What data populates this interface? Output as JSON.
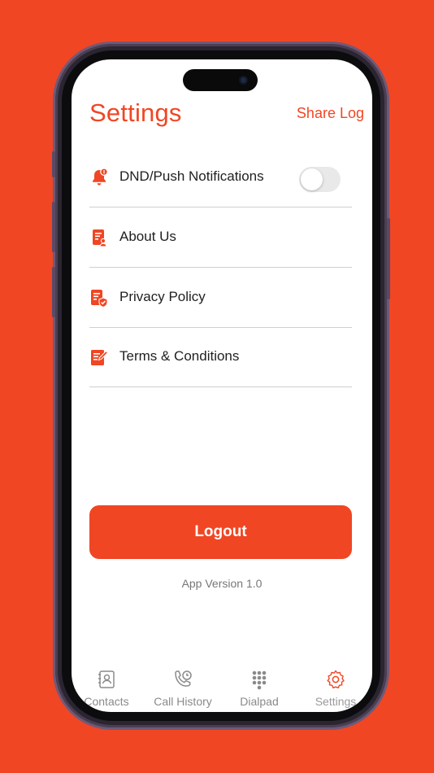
{
  "colors": {
    "accent": "#F04624",
    "background": "#F04624",
    "divider": "#cfcfcf"
  },
  "header": {
    "title": "Settings",
    "action": "Share Log"
  },
  "settings": {
    "items": [
      {
        "label": "DND/Push Notifications",
        "icon": "bell-alert-icon",
        "toggle": false
      },
      {
        "label": "About Us",
        "icon": "document-user-icon"
      },
      {
        "label": "Privacy Policy",
        "icon": "document-shield-icon"
      },
      {
        "label": "Terms & Conditions",
        "icon": "document-edit-icon"
      }
    ]
  },
  "logout": {
    "label": "Logout"
  },
  "app_version": "App Version 1.0",
  "tabbar": {
    "tabs": [
      {
        "label": "Contacts",
        "icon": "contacts-book-icon"
      },
      {
        "label": "Call History",
        "icon": "phone-clock-icon"
      },
      {
        "label": "Dialpad",
        "icon": "dialpad-icon"
      },
      {
        "label": "Settings",
        "icon": "gear-icon",
        "active": true
      }
    ]
  }
}
